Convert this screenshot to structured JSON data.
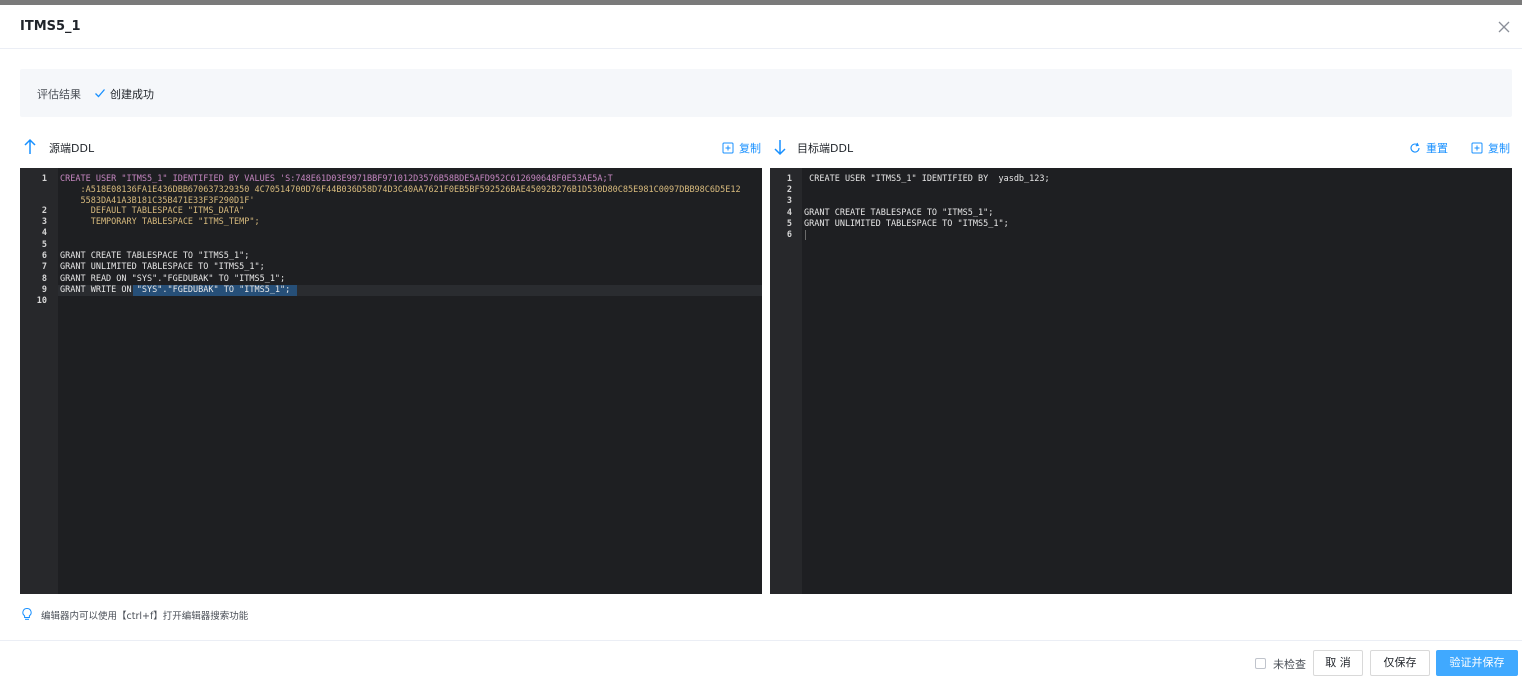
{
  "dialog": {
    "title": "ITMS5_1",
    "close_icon": "close-icon"
  },
  "evaluation": {
    "label": "评估结果",
    "status_icon": "check-icon",
    "status": "创建成功"
  },
  "source_panel": {
    "icon": "arrow-up-icon",
    "title": "源端DDL",
    "copy_icon": "copy-icon",
    "copy_label": "复制"
  },
  "target_panel": {
    "icon": "arrow-down-icon",
    "title": "目标端DDL",
    "reset_icon": "refresh-icon",
    "reset_label": "重置",
    "copy_icon": "copy-icon",
    "copy_label": "复制"
  },
  "source_code": {
    "line_numbers": [
      "1",
      "2",
      "3",
      "4",
      "5",
      "6",
      "7",
      "8",
      "9",
      "10"
    ],
    "lines": [
      "CREATE USER \"ITMS5_1\" IDENTIFIED BY VALUES 'S:748E61D03E9971BBF971012D3576B58BDE5AFD952C612690648F0E53AE5A;T",
      "    :A518E08136FA1E436DBB670637329350 4C70514700D76F44B036D58D74D3C40AA7621F0EB5BF592526BAE45092B276B1D530D80C85E981C0097DBB98C6D5E12",
      "    5583DA41A3B181C35B471E33F3F290D1F'",
      "      DEFAULT TABLESPACE \"ITMS_DATA\"",
      "      TEMPORARY TABLESPACE \"ITMS_TEMP\";",
      "",
      "",
      "GRANT CREATE TABLESPACE TO \"ITMS5_1\";",
      "GRANT UNLIMITED TABLESPACE TO \"ITMS5_1\";",
      "GRANT READ ON \"SYS\".\"FGEDUBAK\" TO \"ITMS5_1\";",
      "GRANT WRITE ON \"SYS\".\"FGEDUBAK\" TO \"ITMS5_1\";",
      ""
    ]
  },
  "target_code": {
    "line_numbers": [
      "1",
      "2",
      "3",
      "4",
      "5",
      "6"
    ],
    "lines": [
      " CREATE USER \"ITMS5_1\" IDENTIFIED BY  yasdb_123;",
      "",
      "",
      "GRANT CREATE TABLESPACE TO \"ITMS5_1\";",
      "GRANT UNLIMITED TABLESPACE TO \"ITMS5_1\";",
      ""
    ]
  },
  "tip": {
    "icon": "lightbulb-icon",
    "text": "编辑器内可以使用【ctrl+f】打开编辑器搜索功能"
  },
  "footer": {
    "unchecked_label": "未检查",
    "cancel_label": "取 消",
    "save_only_label": "仅保存",
    "verify_save_label": "验证并保存"
  },
  "colors": {
    "accent": "#1890ff",
    "primary_button": "#40a9ff",
    "editor_bg": "#1e1f22",
    "keyword": "#c586c0",
    "string": "#d7ba7d"
  }
}
